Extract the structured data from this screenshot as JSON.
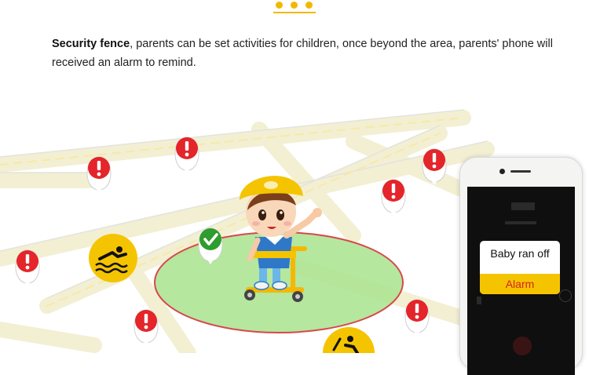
{
  "caption": {
    "bold": "Security fence",
    "rest": ", parents can be set activities for children, once beyond the area, parents' phone will received an alarm to remind."
  },
  "phone": {
    "alert_message": "Baby ran off",
    "alert_button": "Alarm"
  },
  "colors": {
    "accent": "#f2b800",
    "pin_red": "#e4252a",
    "pin_green": "#2e9c2e",
    "fence_fill": "#a8e38e",
    "fence_border": "#d8474a",
    "alert_button": "#f5c400",
    "alert_text": "#d32222"
  },
  "icons": {
    "header": "dots-icon",
    "alarm_pin": "alarm-pin-icon",
    "safe_pin": "check-pin-icon",
    "water": "swimmer-icon",
    "construction": "worker-icon"
  }
}
